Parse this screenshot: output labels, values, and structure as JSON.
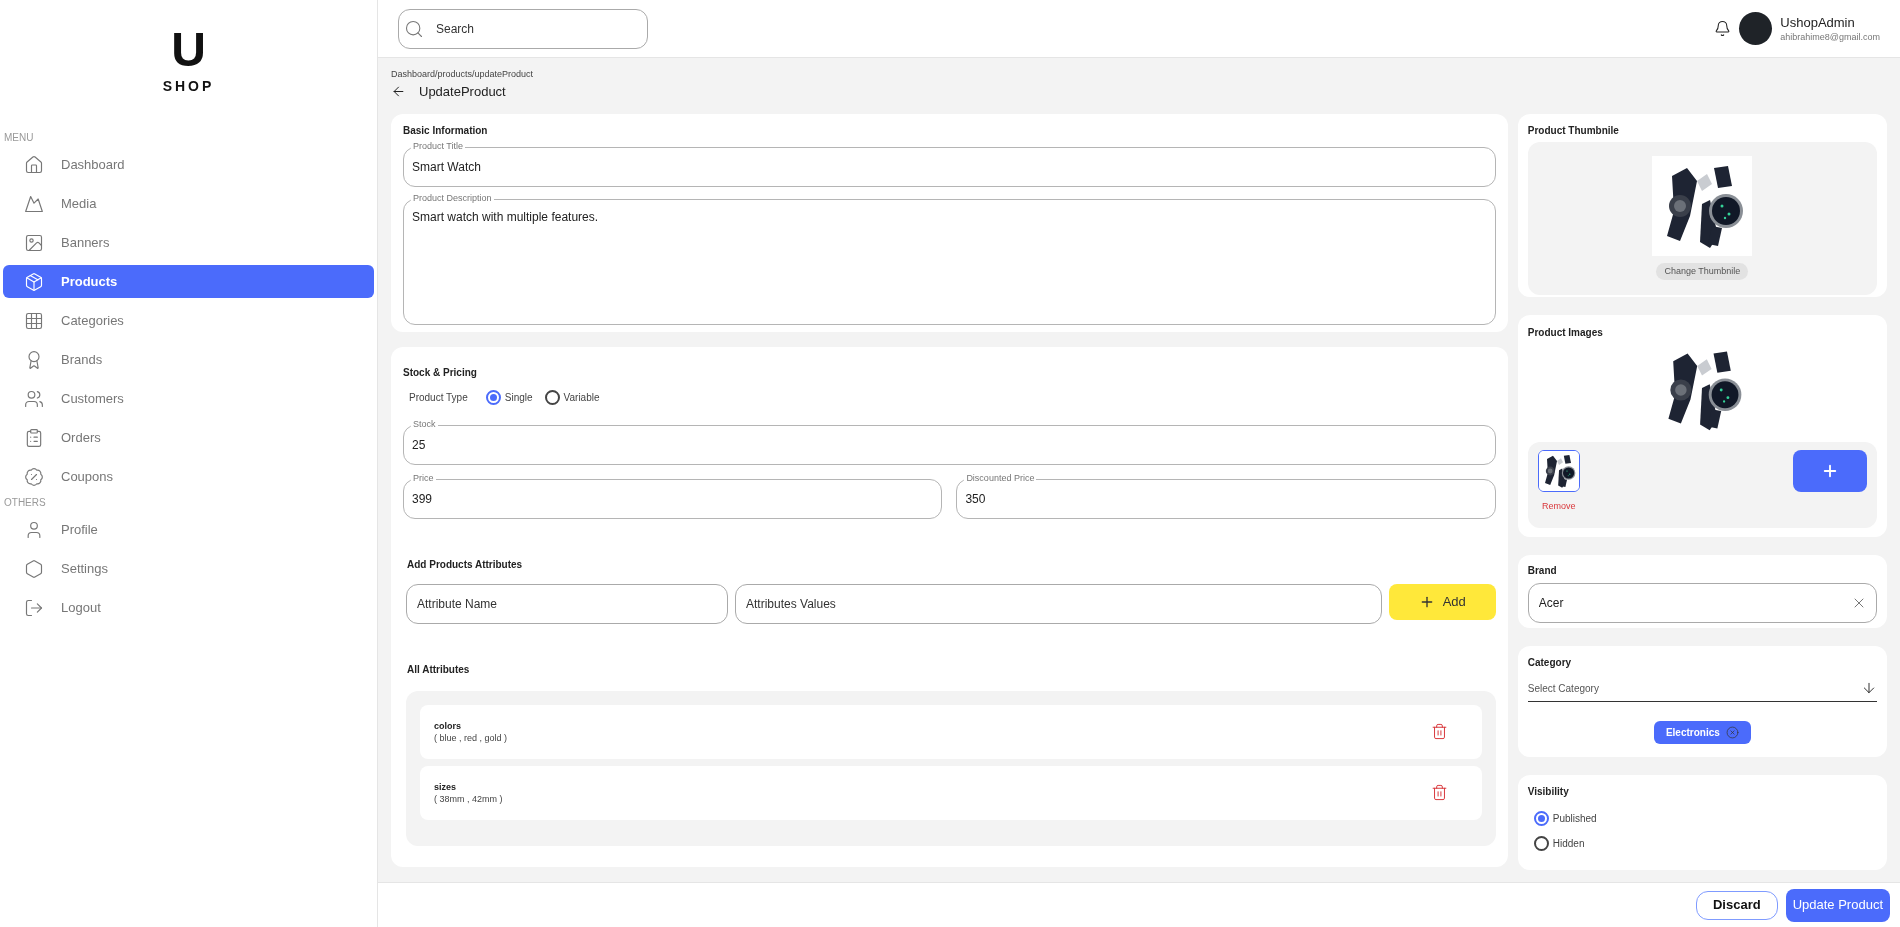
{
  "logo": {
    "letter": "U",
    "name": "SHOP"
  },
  "sidebar": {
    "sections": [
      {
        "heading": "MENU",
        "items": [
          {
            "label": "Dashboard",
            "selected": false
          },
          {
            "label": "Media",
            "selected": false
          },
          {
            "label": "Banners",
            "selected": false
          },
          {
            "label": "Products",
            "selected": true
          },
          {
            "label": "Categories",
            "selected": false
          },
          {
            "label": "Brands",
            "selected": false
          },
          {
            "label": "Customers",
            "selected": false
          },
          {
            "label": "Orders",
            "selected": false
          },
          {
            "label": "Coupons",
            "selected": false
          }
        ]
      },
      {
        "heading": "OTHERS",
        "items": [
          {
            "label": "Profile",
            "selected": false
          },
          {
            "label": "Settings",
            "selected": false
          },
          {
            "label": "Logout",
            "selected": false
          }
        ]
      }
    ]
  },
  "header": {
    "search": {
      "placeholder": "Search"
    },
    "user": {
      "name": "UshopAdmin",
      "email": "ahibrahime8@gmail.com"
    }
  },
  "breadcrumb": "Dashboard/products/updateProduct",
  "page_title": "UpdateProduct",
  "basic_info": {
    "title": "Basic Information",
    "fields": [
      {
        "label": "Product Title",
        "value": "Smart Watch",
        "kind": "input"
      },
      {
        "label": "Product Description",
        "value": "Smart watch with multiple features.",
        "kind": "textarea"
      }
    ]
  },
  "stock_pricing": {
    "title": "Stock & Pricing",
    "product_type": {
      "label": "Product Type",
      "options": [
        {
          "label": "Single",
          "selected": true
        },
        {
          "label": "Variable",
          "selected": false
        }
      ]
    },
    "stock": {
      "label": "Stock",
      "value": "25"
    },
    "price": {
      "label": "Price",
      "value": "399"
    },
    "discounted_price": {
      "label": "Discounted Price",
      "value": "350"
    }
  },
  "attributes": {
    "title": "Add Products Attributes",
    "name_placeholder": "Attribute Name",
    "values_placeholder": "Attributes Values",
    "add_button": "Add",
    "list_title": "All Attributes",
    "items": [
      {
        "name": "colors",
        "values": "( blue , red , gold )"
      },
      {
        "name": "sizes",
        "values": "( 38mm , 42mm )"
      }
    ]
  },
  "thumbnail": {
    "title": "Product Thumbnile",
    "button": "Change Thumbnile"
  },
  "images": {
    "title": "Product Images",
    "remove": "Remove"
  },
  "brand": {
    "title": "Brand",
    "value": "Acer"
  },
  "category": {
    "title": "Category",
    "placeholder": "Select Category",
    "chips": [
      "Electronics"
    ]
  },
  "visibility": {
    "title": "Visibility",
    "options": [
      {
        "label": "Published",
        "selected": true
      },
      {
        "label": "Hidden",
        "selected": false
      }
    ]
  },
  "footer": {
    "buttons": [
      {
        "label": "Discard",
        "kind": "outline"
      },
      {
        "label": "Update Product",
        "kind": "primary"
      }
    ]
  }
}
